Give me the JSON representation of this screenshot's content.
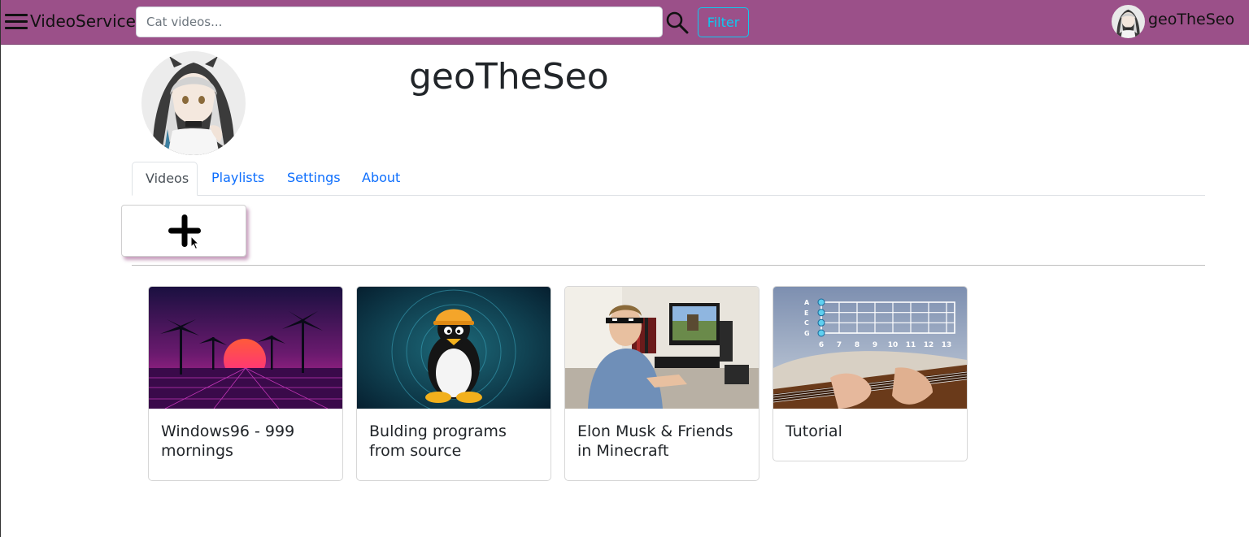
{
  "navbar": {
    "brand": "VideoService",
    "search_placeholder": "Cat videos...",
    "filter_label": "Filter",
    "username": "geoTheSeo",
    "accent_color": "#9b5089"
  },
  "profile": {
    "name": "geoTheSeo"
  },
  "tabs": [
    {
      "label": "Videos",
      "active": true
    },
    {
      "label": "Playlists",
      "active": false
    },
    {
      "label": "Settings",
      "active": false
    },
    {
      "label": "About",
      "active": false
    }
  ],
  "upload": {
    "icon": "plus-icon"
  },
  "videos": [
    {
      "title": "Windows96 - 999 mornings",
      "thumbnail": "synthwave-palm-sunset"
    },
    {
      "title": "Bulding programs from source",
      "thumbnail": "linux-penguin-hardhat"
    },
    {
      "title": "Elon Musk & Friends in Minecraft",
      "thumbnail": "man-at-computer-sunglasses"
    },
    {
      "title": "Tutorial",
      "thumbnail": "ukulele-fretboard-chart"
    }
  ],
  "fretboard": {
    "strings": [
      "A",
      "E",
      "C",
      "G"
    ],
    "frets": [
      "6",
      "7",
      "8",
      "9",
      "10",
      "11",
      "12",
      "13"
    ]
  }
}
